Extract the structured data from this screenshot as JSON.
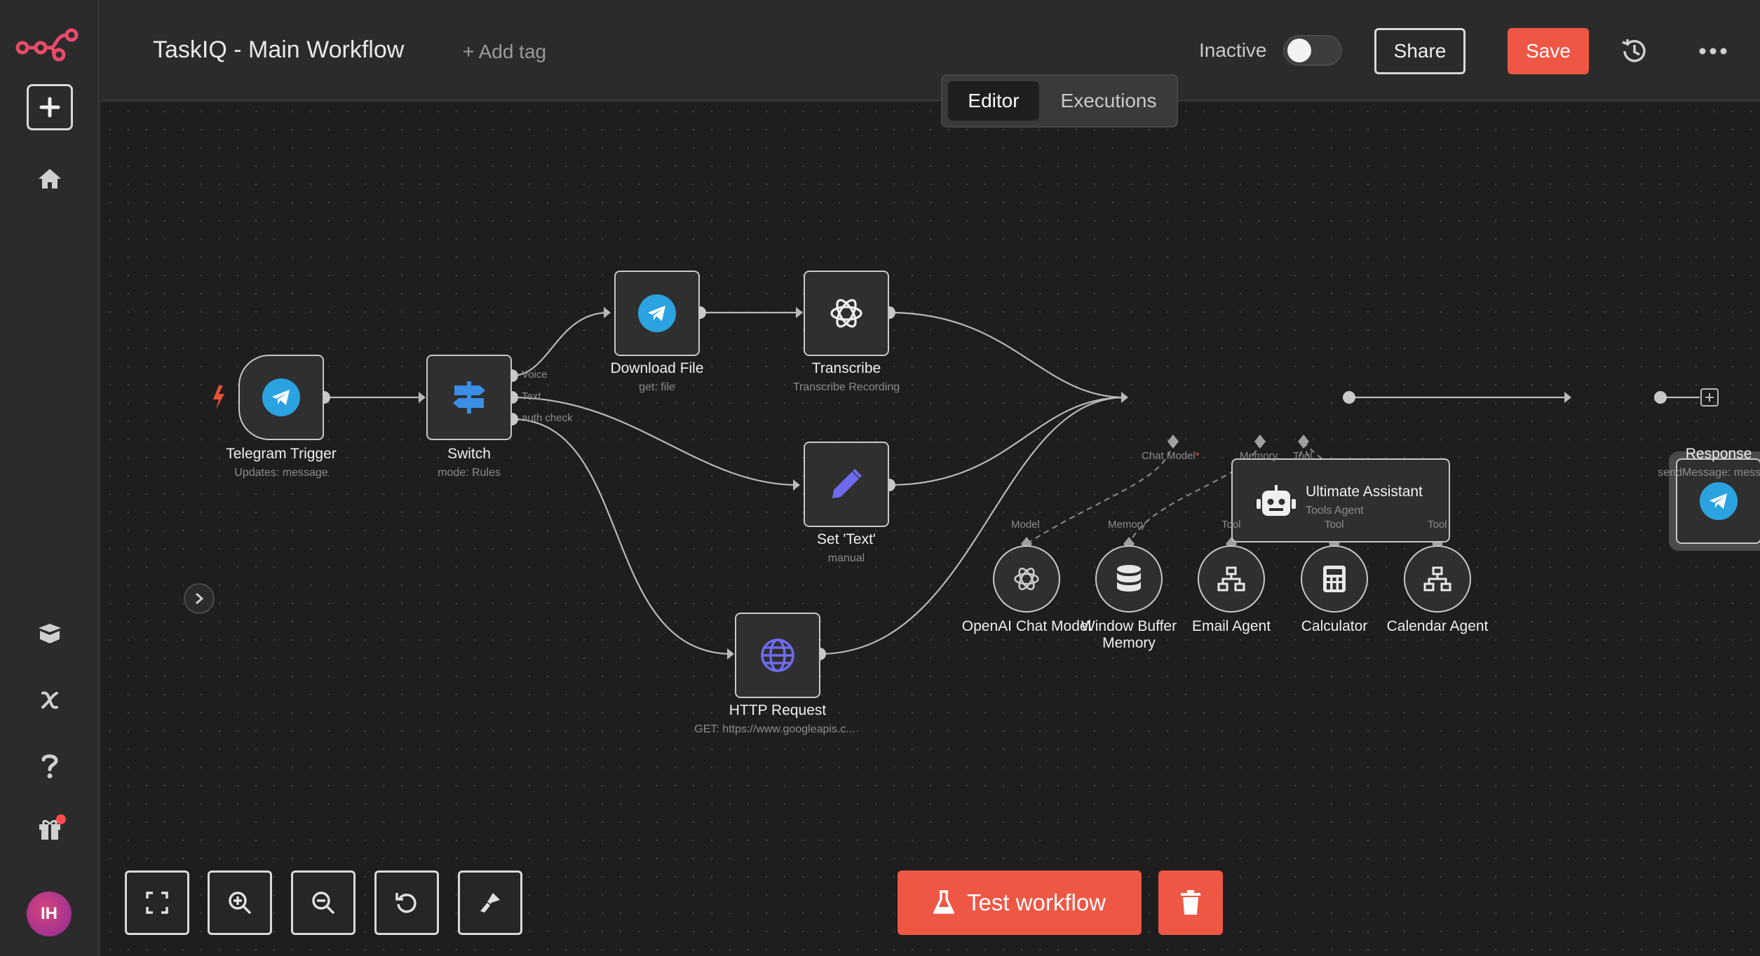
{
  "header": {
    "workflow_title": "TaskIQ - Main Workflow",
    "add_tag": "+ Add tag",
    "status_label": "Inactive",
    "active": false,
    "share_label": "Share",
    "save_label": "Save"
  },
  "tabs": [
    {
      "label": "Editor",
      "selected": true
    },
    {
      "label": "Executions",
      "selected": false
    }
  ],
  "sidebar": {
    "avatar_initials": "IH",
    "icons": [
      "logo-icon",
      "plus-icon",
      "home-icon",
      "templates-icon",
      "variables-icon",
      "help-icon",
      "gift-icon"
    ]
  },
  "nodes": {
    "telegram_trigger": {
      "label": "Telegram Trigger",
      "subtitle": "Updates: message"
    },
    "switch": {
      "label": "Switch",
      "subtitle": "mode: Rules",
      "outputs": [
        "Voice",
        "Text",
        "auth check"
      ]
    },
    "download_file": {
      "label": "Download File",
      "subtitle": "get: file"
    },
    "transcribe": {
      "label": "Transcribe",
      "subtitle": "Transcribe Recording"
    },
    "set_text": {
      "label": "Set 'Text'",
      "subtitle": "manual"
    },
    "http_request": {
      "label": "HTTP Request",
      "subtitle": "GET: https://www.googleapis.c..."
    },
    "ultimate_assistant": {
      "label": "Ultimate Assistant",
      "subtitle": "Tools Agent",
      "inputs": [
        "Chat Model*",
        "Memory",
        "Tool"
      ]
    },
    "response": {
      "label": "Response",
      "subtitle": "sendMessage: message"
    },
    "openai_chat_model": {
      "label": "OpenAI Chat Model",
      "port": "Model"
    },
    "window_buffer_memory": {
      "label": "Window Buffer Memory",
      "port": "Memory"
    },
    "email_agent": {
      "label": "Email Agent",
      "port": "Tool"
    },
    "calculator": {
      "label": "Calculator",
      "port": "Tool"
    },
    "calendar_agent": {
      "label": "Calendar Agent",
      "port": "Tool"
    }
  },
  "footer": {
    "test_workflow_label": "Test workflow",
    "controls": [
      "fit-view-icon",
      "zoom-in-icon",
      "zoom-out-icon",
      "reset-zoom-icon",
      "tidy-up-icon"
    ]
  },
  "colors": {
    "accent": "#ef5745",
    "telegram": "#2aa3e0",
    "switch": "#3a8ee6",
    "pencil": "#6f6bf0",
    "globe": "#6f6bf0",
    "trigger_bolt": "#e8503a"
  }
}
